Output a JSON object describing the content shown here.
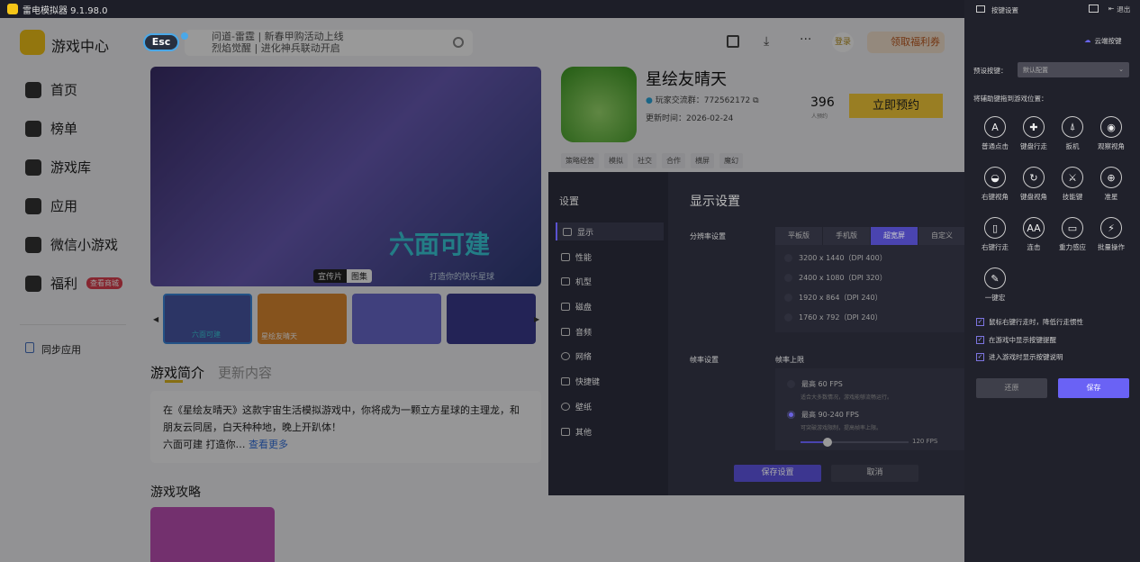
{
  "window": {
    "title": "雷电模拟器 9.1.98.0"
  },
  "sidebar": {
    "title": "游戏中心",
    "items": [
      {
        "label": "首页"
      },
      {
        "label": "榜单"
      },
      {
        "label": "游戏库"
      },
      {
        "label": "应用"
      },
      {
        "label": "微信小游戏"
      },
      {
        "label": "福利",
        "badge": "查看商城"
      }
    ],
    "sync": "同步应用"
  },
  "search": {
    "esc": "Esc",
    "suggestions": [
      "问道-雷霆 | 新春甲购活动上线",
      "烈焰觉醒 | 进化神兵联动开启"
    ]
  },
  "header": {
    "login": "登录",
    "coupon": "领取福利券"
  },
  "banner": {
    "title": "六面可建",
    "subtitle": "打造你的快乐星球",
    "tabs": [
      "宣传片",
      "图集"
    ],
    "thumbs": [
      "六面可建",
      "星绘友晴天",
      "",
      ""
    ]
  },
  "game": {
    "name": "星绘友晴天",
    "group": "玩家交流群：772562172",
    "updated": "更新时间：2026-02-24",
    "count": "396",
    "count_label": "人预约",
    "reserve": "立即预约",
    "tags": [
      "策略经营",
      "模拟",
      "社交",
      "合作",
      "横屏",
      "魔幻"
    ]
  },
  "intro": {
    "tabs": [
      "游戏简介",
      "更新内容"
    ],
    "text1": "在《星绘友晴天》这款宇宙生活模拟游戏中，你将成为一颗立方星球的主理龙，和朋友云同居，白天种种地，晚上开趴体！",
    "text2": "六面可建 打造你…",
    "more": "查看更多",
    "guide": "游戏攻略"
  },
  "settings": {
    "title": "设置",
    "nav": [
      "显示",
      "性能",
      "机型",
      "磁盘",
      "音频",
      "网络",
      "快捷键",
      "壁纸",
      "其他"
    ],
    "heading": "显示设置",
    "res_label": "分辨率设置",
    "res_tabs": [
      "平板版",
      "手机版",
      "超宽屏",
      "自定义"
    ],
    "resolutions": [
      "3200 x 1440（DPI 400）",
      "2400 x 1080（DPI 320）",
      "1920 x 864（DPI 240）",
      "1760 x 792（DPI 240）"
    ],
    "fps_label": "帧率设置",
    "fps_cap": "帧率上限",
    "fps_opt1": "最高 60 FPS",
    "fps_opt1_desc": "适合大多数情况，游戏能够流畅运行。",
    "fps_opt2": "最高 90-240 FPS",
    "fps_opt2_desc": "可突破游戏限制，提高帧率上限。",
    "fps_value": "120 FPS",
    "fps_slider_fraction": 0.25,
    "save": "保存设置",
    "cancel": "取消"
  },
  "panel": {
    "title": "按键设置",
    "exit": "退出",
    "cloud": "云端按键",
    "preset_label": "预设按键：",
    "preset_value": "默认配置",
    "drag_hint": "将辅助键拖到游戏位置：",
    "keys": [
      {
        "label": "普通点击",
        "glyph": "A"
      },
      {
        "label": "键盘行走",
        "glyph": "✚"
      },
      {
        "label": "扳机",
        "glyph": "⍋"
      },
      {
        "label": "观察视角",
        "glyph": "◉"
      },
      {
        "label": "右键视角",
        "glyph": "◒"
      },
      {
        "label": "键盘视角",
        "glyph": "↻"
      },
      {
        "label": "技能键",
        "glyph": "⚔"
      },
      {
        "label": "准星",
        "glyph": "⊕"
      },
      {
        "label": "右键行走",
        "glyph": "▯"
      },
      {
        "label": "连击",
        "glyph": "AA"
      },
      {
        "label": "重力感应",
        "glyph": "▭"
      },
      {
        "label": "批量操作",
        "glyph": "⚡"
      },
      {
        "label": "一键宏",
        "glyph": "✎"
      }
    ],
    "options": [
      "鼠标右键行走时，降低行走惯性",
      "在游戏中显示按键提醒",
      "进入游戏时显示按键说明"
    ],
    "reset": "还原",
    "save": "保存"
  }
}
